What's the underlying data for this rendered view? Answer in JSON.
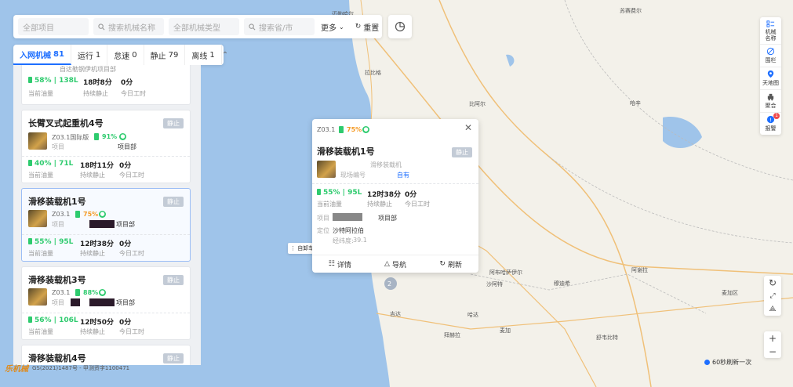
{
  "search": {
    "project_placeholder": "全部项目",
    "machine_name_placeholder": "搜索机械名称",
    "machine_type_placeholder": "全部机械类型",
    "province_placeholder": "搜索省/市",
    "more_label": "更多",
    "reset_label": "重置"
  },
  "tabs": [
    {
      "label": "入网机械",
      "count": "81"
    },
    {
      "label": "运行",
      "count": "1"
    },
    {
      "label": "怠速",
      "count": "0"
    },
    {
      "label": "静止",
      "count": "79"
    },
    {
      "label": "离线",
      "count": "1"
    }
  ],
  "cards": [
    {
      "title": "",
      "battery": "58%",
      "fuel": "138L",
      "duration": "18时8分",
      "work": "0分",
      "fuel_label": "当前油量",
      "duration_label": "持续静止",
      "work_label": "今日工时",
      "project": "自达勒钢伊机项目部"
    },
    {
      "title": "长臂叉式起重机4号",
      "tag": "静止",
      "model": "Z03.1国际版",
      "pct": "91%",
      "plabel": "项目",
      "project": "项目部",
      "battery": "40%",
      "fuel": "71L",
      "duration": "18时11分",
      "work": "0分",
      "fuel_label": "当前油量",
      "duration_label": "持续静止",
      "work_label": "今日工时"
    },
    {
      "title": "滑移装载机1号",
      "tag": "静止",
      "model": "Z03.1",
      "pct": "75%",
      "plabel": "项目",
      "project": "项目部",
      "battery": "55%",
      "fuel": "95L",
      "duration": "12时38分",
      "work": "0分",
      "fuel_label": "当前油量",
      "duration_label": "持续静止",
      "work_label": "今日工时"
    },
    {
      "title": "滑移装载机3号",
      "tag": "静止",
      "model": "Z03.1",
      "pct": "88%",
      "plabel": "项目",
      "project": "项目部",
      "battery": "56%",
      "fuel": "106L",
      "duration": "12时50分",
      "work": "0分",
      "fuel_label": "当前油量",
      "duration_label": "持续静止",
      "work_label": "今日工时"
    },
    {
      "title": "滑移装载机4号",
      "tag": "静止"
    }
  ],
  "popup": {
    "model": "Z03.1",
    "pct": "75%",
    "title": "滑移装载机1号",
    "tag": "静止",
    "type": "滑移装载机",
    "field_label": "现场编号",
    "own": "自有",
    "battery": "55%",
    "fuel": "95L",
    "duration": "12时38分",
    "work": "0分",
    "fuel_label": "当前油量",
    "duration_label": "持续静止",
    "work_label": "今日工时",
    "project_label": "项目",
    "project": "项目部",
    "location_label": "定位",
    "location": "沙特阿拉伯",
    "latlng_label": "经纬度:",
    "latlng": "39.1",
    "detail_label": "详情",
    "navigate_label": "导航",
    "refresh_label": "刷新"
  },
  "autoswitch_label": "自卸车",
  "right_toolbar": [
    {
      "label": "机械名称",
      "icon": "list-icon"
    },
    {
      "label": "围栏",
      "icon": "fence-icon"
    },
    {
      "label": "天地图",
      "icon": "location-icon"
    },
    {
      "label": "聚合",
      "icon": "cluster-icon"
    },
    {
      "label": "报警",
      "icon": "alarm-icon",
      "badge": "1"
    }
  ],
  "map_labels": [
    {
      "text": "苏赛费尔",
      "id": "city-1"
    },
    {
      "text": "迈勒哈尔",
      "id": "city-2"
    },
    {
      "text": "拉比格",
      "id": "city-3"
    },
    {
      "text": "比阿尔",
      "id": "city-4"
    },
    {
      "text": "哈辛",
      "id": "city-5"
    },
    {
      "text": "阿布哈萨伊尔",
      "id": "city-6"
    },
    {
      "text": "沙阿特",
      "id": "city-7"
    },
    {
      "text": "穆迪希",
      "id": "city-8"
    },
    {
      "text": "阿谢拉",
      "id": "city-9"
    },
    {
      "text": "麦加区",
      "id": "city-10"
    },
    {
      "text": "吉达",
      "id": "city-11"
    },
    {
      "text": "哈达",
      "id": "city-12"
    },
    {
      "text": "拜赫拉",
      "id": "city-13"
    },
    {
      "text": "麦加",
      "id": "city-14"
    },
    {
      "text": "舒韦比特",
      "id": "city-15"
    }
  ],
  "refresh_text": "60秒刷新一次",
  "copyright": "GS(2021)1487号 - 甲测资字1100471",
  "logo_text": "乐机械",
  "colors": {
    "accent": "#1e6fff",
    "green": "#2ecb6e",
    "orange": "#f59a23",
    "sea": "#9fc4ea"
  }
}
